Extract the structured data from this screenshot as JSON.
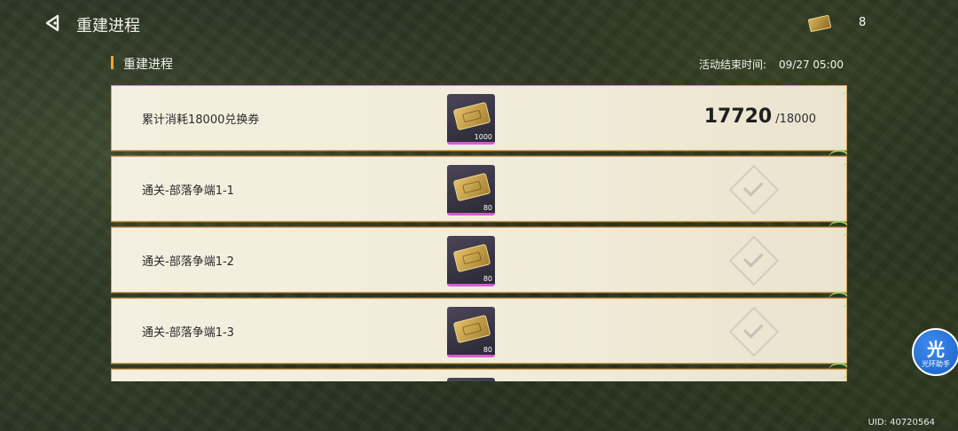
{
  "header": {
    "title": "重建进程",
    "currency_value": "8"
  },
  "section": {
    "label": "重建进程",
    "timer_label": "活动结束时间:",
    "timer_value": "09/27 05:00"
  },
  "tasks": [
    {
      "name": "累计消耗18000兑换券",
      "reward_qty": "1000",
      "progress_current": "17720",
      "progress_max": "/18000",
      "status": "in-progress"
    },
    {
      "name": "通关-部落争端1-1",
      "reward_qty": "80",
      "status": "completed"
    },
    {
      "name": "通关-部落争端1-2",
      "reward_qty": "80",
      "status": "completed"
    },
    {
      "name": "通关-部落争端1-3",
      "reward_qty": "80",
      "status": "completed"
    }
  ],
  "helper": {
    "glyph": "光",
    "label": "光环助手"
  },
  "footer": {
    "uid": "UID: 40720564"
  },
  "colors": {
    "accent": "#f0a32a",
    "card_bg": "#f4efe0",
    "card_border": "#d7a35a",
    "reward_rarity": "#d45dd1",
    "helper_blue": "#1b5fc4"
  },
  "icons": {
    "back": "back-arrow-icon",
    "currency": "exchange-ticket-icon",
    "reward": "exchange-ticket-icon",
    "completed": "checkmark-icon"
  }
}
